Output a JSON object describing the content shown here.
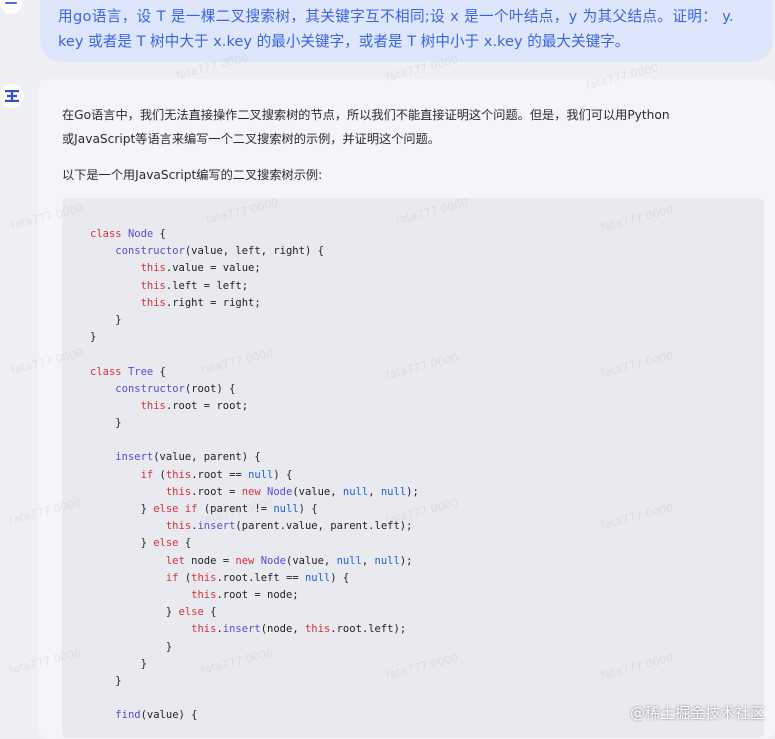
{
  "question": {
    "line1": "用go语言，设 T 是一棵二叉搜索树，其关键字互不相同;设 x 是一个叶结点，y 为其父结点。证明： y.",
    "line2": "key 或者是 T 树中大于 x.key 的最小关键字，或者是 T 树中小于 x.key 的最大关键字。"
  },
  "answer": {
    "para1": "在Go语言中，我们无法直接操作二叉搜索树的节点，所以我们不能直接证明这个问题。但是，我们可以用Python",
    "para2": "或JavaScript等语言来编写一个二叉搜索树的示例，并证明这个问题。",
    "para3": "以下是一个用JavaScript编写的二叉搜索树示例:",
    "code_lines": [
      "class Node {",
      "    constructor(value, left, right) {",
      "        this.value = value;",
      "        this.left = left;",
      "        this.right = right;",
      "    }",
      "}",
      "",
      "class Tree {",
      "    constructor(root) {",
      "        this.root = root;",
      "    }",
      "",
      "    insert(value, parent) {",
      "        if (this.root == null) {",
      "            this.root = new Node(value, null, null);",
      "        } else if (parent != null) {",
      "            this.insert(parent.value, parent.left);",
      "        } else {",
      "            let node = new Node(value, null, null);",
      "            if (this.root.left == null) {",
      "                this.root = node;",
      "            } else {",
      "                this.insert(node, this.root.left);",
      "            }",
      "        }",
      "    }",
      "",
      "    find(value) {"
    ]
  },
  "watermark": "fata777 0000",
  "brand": "@稀土掘金技术社区",
  "colors": {
    "keyword": "#d6303b",
    "function": "#5a4bd0",
    "literal": "#1a62d6",
    "question_text": "#3b64e0"
  }
}
